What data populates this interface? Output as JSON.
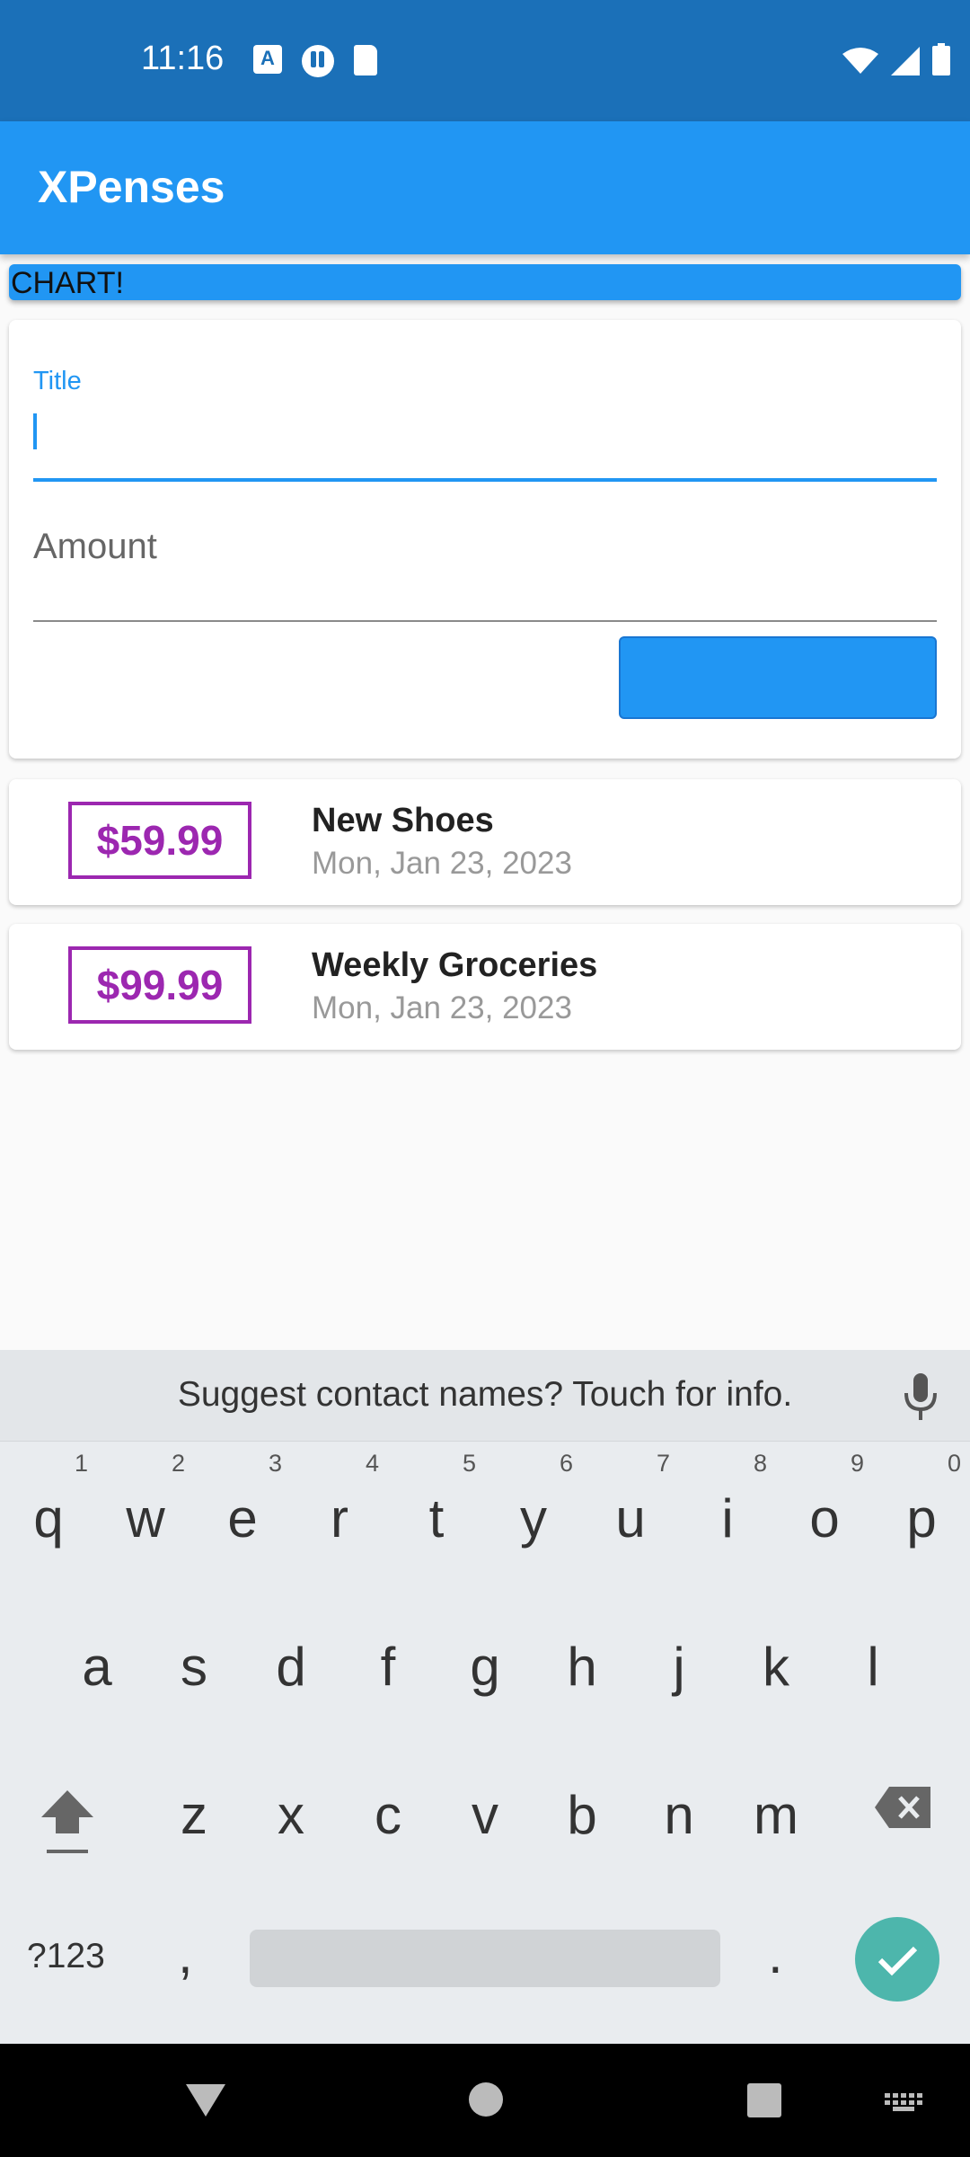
{
  "status_bar": {
    "time": "11:16"
  },
  "app_bar": {
    "title": "XPenses"
  },
  "chart": {
    "label": "CHART!"
  },
  "form": {
    "title_label": "Title",
    "title_value": "",
    "amount_label": "Amount",
    "add_button_label": ""
  },
  "transactions": [
    {
      "amount": "$59.99",
      "title": "New Shoes",
      "date": "Mon, Jan 23, 2023"
    },
    {
      "amount": "$99.99",
      "title": "Weekly Groceries",
      "date": "Mon, Jan 23, 2023"
    }
  ],
  "keyboard": {
    "suggestion": "Suggest contact names? Touch for info.",
    "row1": [
      "q",
      "w",
      "e",
      "r",
      "t",
      "y",
      "u",
      "i",
      "o",
      "p"
    ],
    "row1_hints": [
      "1",
      "2",
      "3",
      "4",
      "5",
      "6",
      "7",
      "8",
      "9",
      "0"
    ],
    "row2": [
      "a",
      "s",
      "d",
      "f",
      "g",
      "h",
      "j",
      "k",
      "l"
    ],
    "row3": [
      "z",
      "x",
      "c",
      "v",
      "b",
      "n",
      "m"
    ],
    "symbols_label": "?123",
    "comma": ",",
    "period": "."
  },
  "icons": {
    "status": [
      "a-notification-icon",
      "app-notification-icon",
      "sd-card-icon",
      "wifi-icon",
      "signal-icon",
      "battery-icon"
    ],
    "keyboard": [
      "mic-icon",
      "shift-icon",
      "backspace-icon",
      "done-check-icon"
    ],
    "nav": [
      "back-icon",
      "home-icon",
      "recents-icon",
      "keyboard-switch-icon"
    ]
  },
  "colors": {
    "status_bar": "#1b70b8",
    "primary": "#2196f3",
    "amount_accent": "#9c27b0",
    "done_button": "#4db6ac"
  }
}
